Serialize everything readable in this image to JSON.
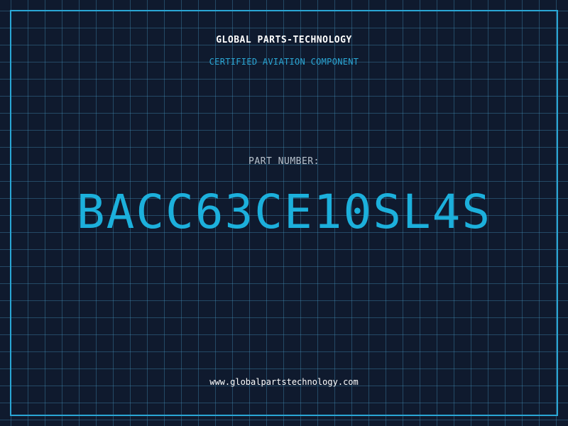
{
  "header": {
    "company_name": "GLOBAL PARTS-TECHNOLOGY",
    "tagline": "CERTIFIED AVIATION COMPONENT"
  },
  "part": {
    "label": "PART NUMBER:",
    "number": "BACC63CE10SL4S"
  },
  "footer": {
    "website": "www.globalpartstechnology.com"
  },
  "colors": {
    "background": "#0f1a2e",
    "accent": "#2aa6d4",
    "part_number": "#1cb0dc",
    "label": "#b7c1cc",
    "text": "#ffffff"
  }
}
